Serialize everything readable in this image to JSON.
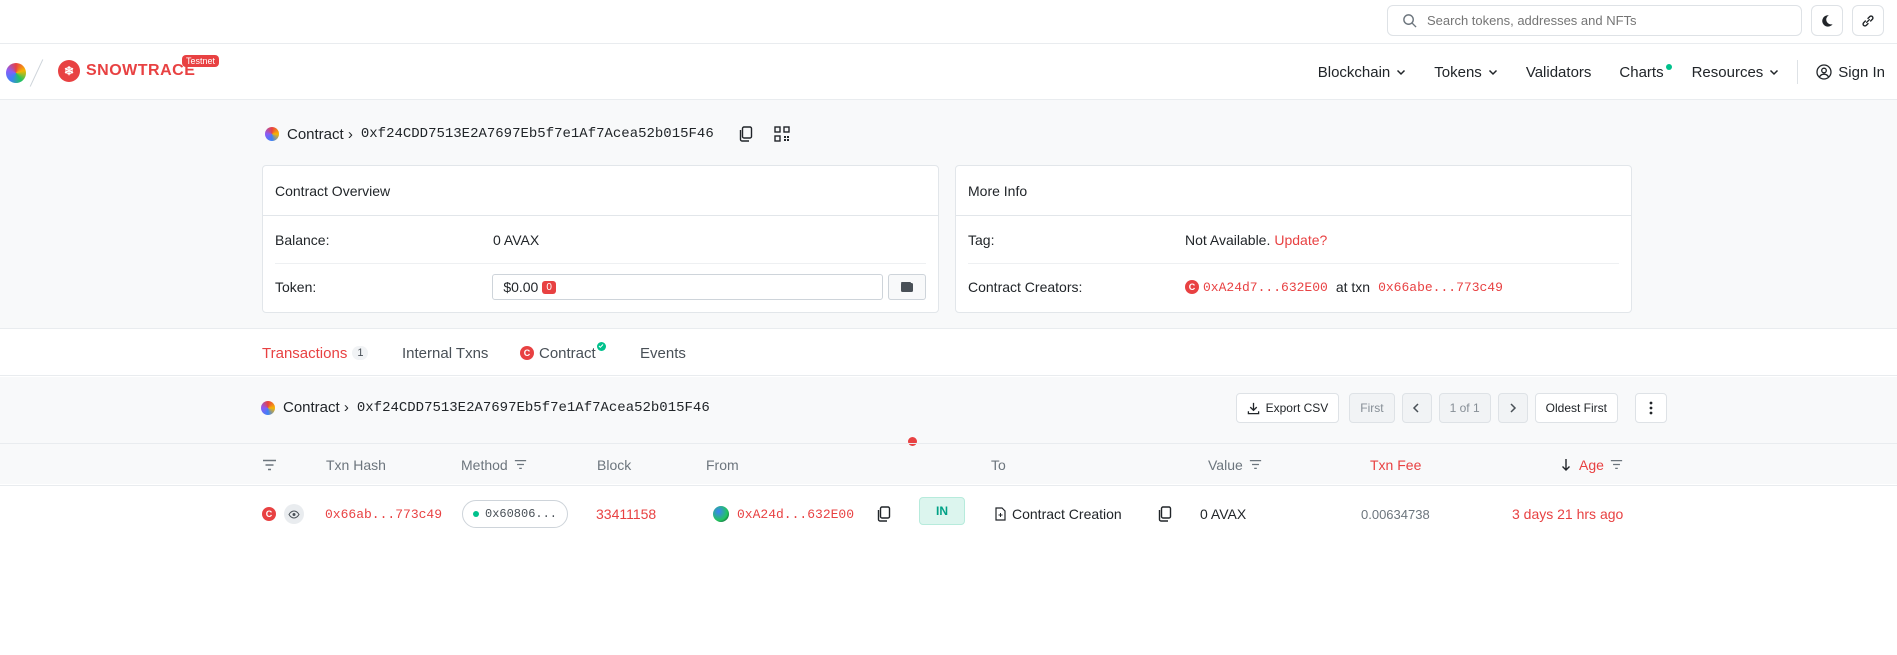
{
  "search": {
    "placeholder": "Search tokens, addresses and NFTs"
  },
  "brand": {
    "name": "SNOWTRACE",
    "badge": "Testnet"
  },
  "nav": {
    "items": [
      {
        "label": "Blockchain"
      },
      {
        "label": "Tokens"
      },
      {
        "label": "Validators"
      },
      {
        "label": "Charts"
      },
      {
        "label": "Resources"
      }
    ],
    "signin": "Sign In"
  },
  "breadcrumb": {
    "label": "Contract ›",
    "address": "0xf24CDD7513E2A7697Eb5f7e1Af7Acea52b015F46"
  },
  "overview": {
    "title": "Contract Overview",
    "balance_label": "Balance:",
    "balance_value": "0 AVAX",
    "token_label": "Token:",
    "token_value": "$0.00",
    "token_count": "0"
  },
  "moreinfo": {
    "title": "More Info",
    "tag_label": "Tag:",
    "tag_value": "Not Available.",
    "tag_link": "Update?",
    "creators_label": "Contract Creators:",
    "creator_address": "0xA24d7...632E00",
    "at_txn": "at txn",
    "creator_txn": "0x66abe...773c49"
  },
  "tabs": {
    "transactions": "Transactions",
    "transactions_count": "1",
    "internal": "Internal Txns",
    "contract": "Contract",
    "events": "Events"
  },
  "panel": {
    "crumb_label": "Contract ›",
    "crumb_address": "0xf24CDD7513E2A7697Eb5f7e1Af7Acea52b015F46",
    "export": "Export CSV",
    "first": "First",
    "page": "1 of 1",
    "sort": "Oldest First"
  },
  "columns": {
    "txn_hash": "Txn Hash",
    "method": "Method",
    "block": "Block",
    "from": "From",
    "to": "To",
    "value": "Value",
    "txn_fee": "Txn Fee",
    "age": "Age"
  },
  "rows": [
    {
      "hash": "0x66ab...773c49",
      "method": "0x60806...",
      "block": "33411158",
      "from": "0xA24d...632E00",
      "direction": "IN",
      "to": "Contract Creation",
      "value": "0 AVAX",
      "fee": "0.00634738",
      "age": "3 days 21 hrs ago"
    }
  ],
  "colors": {
    "accent": "#e84142",
    "success": "#00c18c",
    "background": "#f8f9fa"
  }
}
